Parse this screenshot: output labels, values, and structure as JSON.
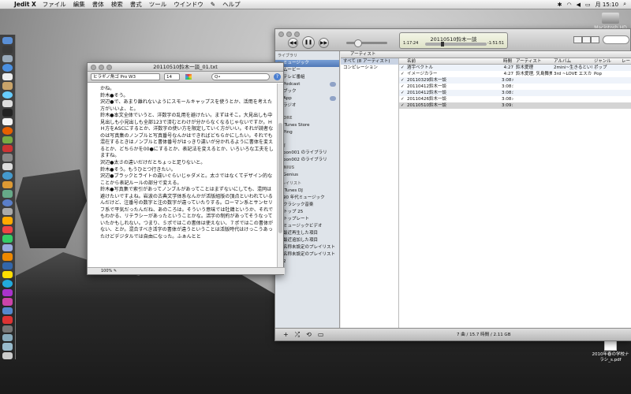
{
  "menubar": {
    "app": "Jedit X",
    "items": [
      "ファイル",
      "編集",
      "書体",
      "検索",
      "書式",
      "ツール",
      "ウインドウ",
      "ヘルプ"
    ],
    "clock": "月 15:10"
  },
  "desktop": {
    "hd_label": "Macintosh HD",
    "pdf_label": "2010年春の学校ナラシ_s.pdf"
  },
  "jedit": {
    "title": "20110510鈴木一談_01.txt",
    "font": "ヒラギノ角ゴ Pro W3",
    "size": "14",
    "search_placeholder": "Q•",
    "zoom": "100%",
    "paragraphs": [
      "かね。",
      "鈴木●そう。",
      "沢辺●で、あまり離れないようにスモールキャップスを使うとか、活用を考えた方がいいよ、と。",
      "鈴木●本文全体でいうと、洋数字の乱用を避けたい。まずはそこ。大見出しも中見出しも小見出しも全部123で済むとわけが分からなくなるじゃないですか。ＨＨ方をASCにするとか、洋数字の使い方を限定していく方がいい。それが読者なのは写真集のノンブルと写真番号なんかはできればどちらかにしたい。それでも混在するときはノンブルと書体番号がはっきり違いが分かれるように書体を変えるとか、どちらかを00●にするとか、表記法を変えるとか、いろいろな工夫をしますね。",
      "沢辺●太さの違いだけだとちょっと足りないと。",
      "鈴木●そう。もうひとつ行きたい。",
      "沢辺●ブラックとライトの違いぐらいじゃダメと。太さではなくてデザイン的なことから表記ルールの部分で変える。",
      "鈴木●写真集で索引があってノンブルがあってことはまずないにしても、混同は避けたいですよね。岩波の古典文学体系なんかが活版組版の頂点といわれているんだけど、注番号の数字と注の数字が違っていたりする。ローマン系とサンセリフ系で平気だったんだね、あのころは。そういう意味では牡錆というか、それでもわかる、リテラシーがあったということかな。活字の制約があってそうなっていたかもしれない。つまり、５ポではこの書体は使えない、７ポではこの書体がない、とか。混合すべき活字の書体が違うということは活版時代はけっこうあったけどデジタルでは自由になった。ふぁんとと"
    ]
  },
  "itunes": {
    "now_playing": "20110510鈴木一談",
    "elapsed": "1:17:24",
    "remaining": "-1:51:51",
    "sidebar": [
      {
        "type": "header",
        "label": "ライブラリ"
      },
      {
        "type": "item",
        "label": "ミュージック",
        "selected": true
      },
      {
        "type": "item",
        "label": "ムービー"
      },
      {
        "type": "item",
        "label": "テレビ番組"
      },
      {
        "type": "item",
        "label": "Podcast",
        "badge": true
      },
      {
        "type": "item",
        "label": "ブック"
      },
      {
        "type": "item",
        "label": "App",
        "badge": true
      },
      {
        "type": "item",
        "label": "ラジオ"
      },
      {
        "type": "gap"
      },
      {
        "type": "header",
        "label": "STORE"
      },
      {
        "type": "item",
        "label": "iTunes Store"
      },
      {
        "type": "item",
        "label": "Ping"
      },
      {
        "type": "gap"
      },
      {
        "type": "header",
        "label": "共有"
      },
      {
        "type": "item",
        "label": "pon001 のライブラリ"
      },
      {
        "type": "item",
        "label": "pon002 のライブラリ"
      },
      {
        "type": "header",
        "label": "GENIUS"
      },
      {
        "type": "item",
        "label": "Genius"
      },
      {
        "type": "header",
        "label": "プレイリスト"
      },
      {
        "type": "item",
        "label": "iTunes DJ"
      },
      {
        "type": "item",
        "label": "90 年代ミュージック"
      },
      {
        "type": "item",
        "label": "クラシック音楽"
      },
      {
        "type": "item",
        "label": "トップ 25"
      },
      {
        "type": "item",
        "label": "トップレート"
      },
      {
        "type": "item",
        "label": "ミュージックビデオ"
      },
      {
        "type": "item",
        "label": "最近再生した項目"
      },
      {
        "type": "item",
        "label": "最近追加した項目"
      },
      {
        "type": "item",
        "label": "名称未設定のプレイリスト"
      },
      {
        "type": "item",
        "label": "名称未設定のプレイリスト 2"
      }
    ],
    "browser_header": "アーティスト",
    "artists": [
      "すべて (8 アーティスト)",
      "コンピレーション"
    ],
    "columns": [
      "名前",
      "時間",
      "アーティスト",
      "アルバム",
      "ジャンル",
      "レート"
    ],
    "tracks": [
      {
        "name": "酒宇ベクトル",
        "time": "4:27",
        "artist": "鈴木愛理",
        "album": "2mini~生きるといいね~",
        "genre": "ポップ"
      },
      {
        "name": "イメージカラー",
        "time": "4:27",
        "artist": "鈴木愛理, 矢島舞美",
        "album": "3rd ~LOVE エスカレー...",
        "genre": "Pop"
      },
      {
        "name": "20110329鈴木一談",
        "time": "3:08:00",
        "artist": "",
        "album": "",
        "genre": ""
      },
      {
        "name": "20110412鈴木一談",
        "time": "3:08:52",
        "artist": "",
        "album": "",
        "genre": ""
      },
      {
        "name": "20110412鈴木一談",
        "time": "3:08:52",
        "artist": "",
        "album": "",
        "genre": ""
      },
      {
        "name": "20110426鈴木一談",
        "time": "3:08:47",
        "artist": "",
        "album": "",
        "genre": ""
      },
      {
        "name": "20110510鈴木一談",
        "time": "3:09:15",
        "artist": "",
        "album": "",
        "genre": "",
        "selected": true
      }
    ],
    "status": "7 曲 / 15.7 時間 / 2.11 GB"
  }
}
